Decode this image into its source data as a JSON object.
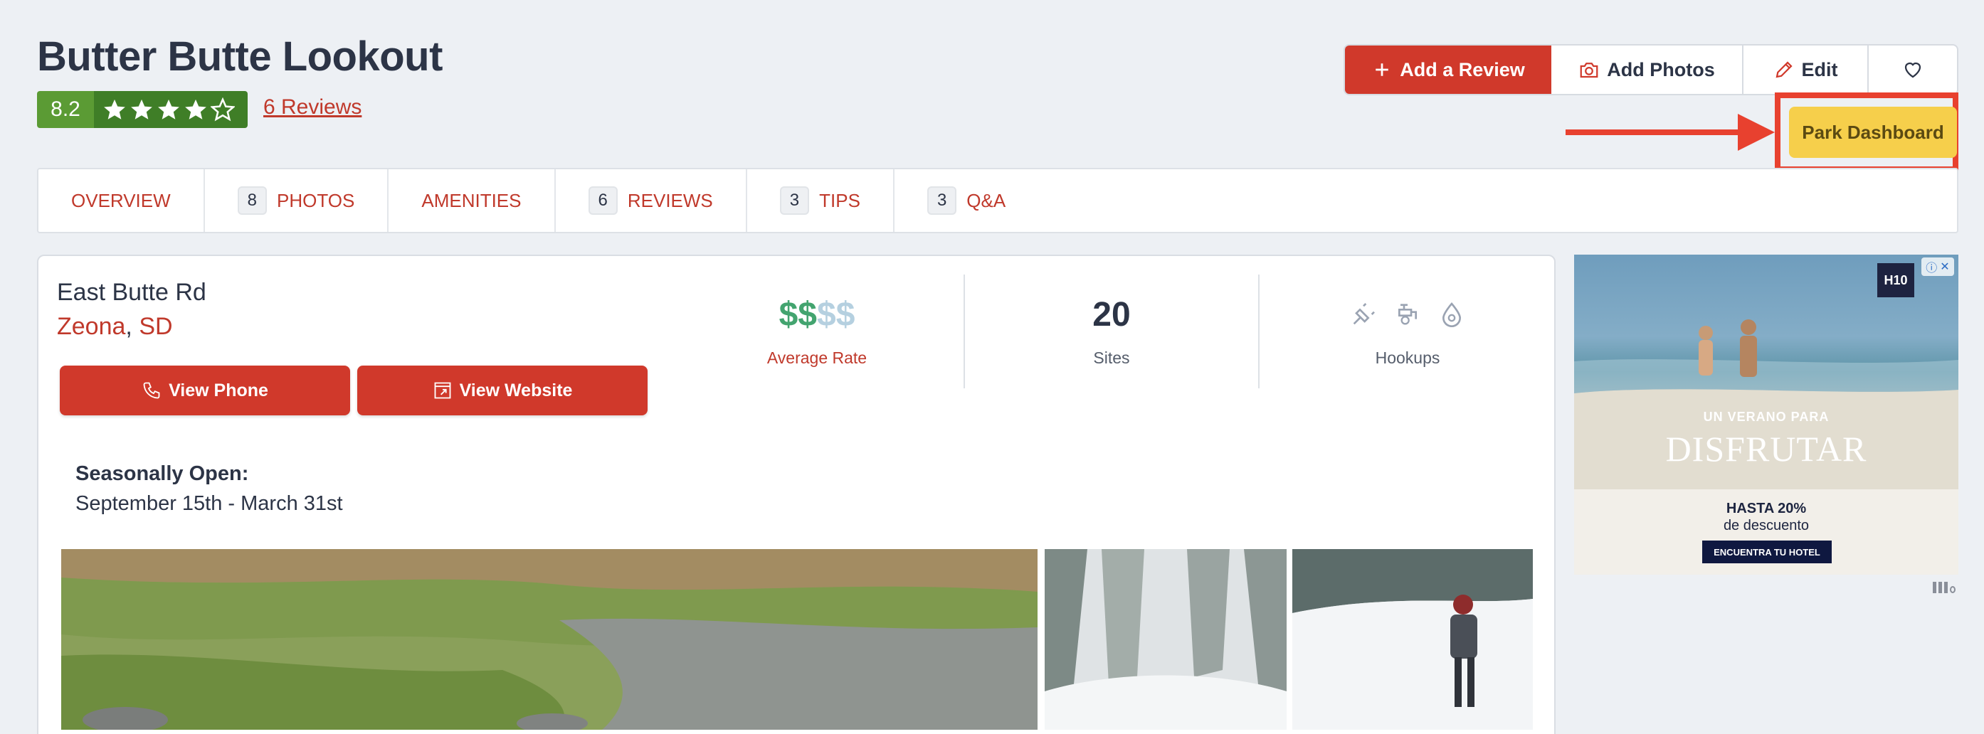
{
  "park": {
    "title": "Butter Butte Lookout",
    "rating": "8.2",
    "stars": 4,
    "stars_max": 5,
    "reviews_link": "6 Reviews"
  },
  "actions": {
    "add_review": "Add a Review",
    "add_photos": "Add Photos",
    "edit": "Edit",
    "favorite_icon": "heart-icon",
    "park_dashboard": "Park Dashboard"
  },
  "tabs": [
    {
      "count": "",
      "label": "OVERVIEW"
    },
    {
      "count": "8",
      "label": "PHOTOS"
    },
    {
      "count": "",
      "label": "AMENITIES"
    },
    {
      "count": "6",
      "label": "REVIEWS"
    },
    {
      "count": "3",
      "label": "TIPS"
    },
    {
      "count": "3",
      "label": "Q&A"
    }
  ],
  "address": {
    "street": "East Butte Rd",
    "city": "Zeona",
    "comma": ",",
    "state": "SD"
  },
  "buttons": {
    "view_phone": "View Phone",
    "view_website": "View Website"
  },
  "stats": {
    "rate_on": "$$",
    "rate_off": "$$",
    "rate_label": "Average Rate",
    "sites_value": "20",
    "sites_label": "Sites",
    "hookups_label": "Hookups"
  },
  "season": {
    "label": "Seasonally Open:",
    "value": "September 15th - March 31st"
  },
  "ad": {
    "logo": "H10",
    "line1": "UN VERANO PARA",
    "line2": "DISFRUTAR",
    "line3": "HASTA 20%",
    "line4": "de descuento",
    "cta": "ENCUENTRA TU HOTEL"
  },
  "colors": {
    "brand_red": "#d0392b",
    "rating_green": "#5b9b34",
    "dashboard_yellow": "#f6cf4b",
    "highlight_red": "#e8412f",
    "price_green": "#43a46f"
  }
}
